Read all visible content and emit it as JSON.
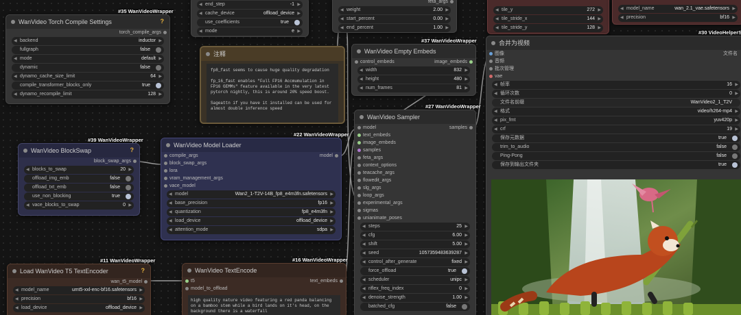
{
  "tags": {
    "compile": "#35 WanVideoWrapper",
    "note_top": "#37 WanVideoWrapper",
    "blockswap": "#39 WanVideoWrapper",
    "loader": "#22 WanVideoWrapper",
    "sampler": "#27 WanVideoWrapper",
    "t5": "#11 WanVideoWrapper",
    "textencode": "#16 WanVideoWrapper",
    "combine": "#30 VideoHelperSui"
  },
  "topleft_partial": {
    "end_step": {
      "label": "end_step",
      "value": "-1"
    },
    "cache_device": {
      "label": "cache_device",
      "value": "offload_device"
    },
    "use_coefficients": {
      "label": "use_coefficients",
      "value": "true"
    },
    "mode": {
      "label": "mode",
      "value": "e"
    }
  },
  "top_mid_partial": {
    "label": "feta_args",
    "weight": {
      "label": "weight",
      "value": "2.00"
    },
    "start_percent": {
      "label": "start_percent",
      "value": "0.00"
    },
    "end_percent": {
      "label": "end_percent",
      "value": "1.00"
    }
  },
  "top_right_partial": {
    "tile_y": {
      "label": "tile_y",
      "value": "272"
    },
    "tile_stride_x": {
      "label": "tile_stride_x",
      "value": "144"
    },
    "tile_stride_y": {
      "label": "tile_stride_y",
      "value": "128"
    },
    "model_name": {
      "label": "model_name",
      "value": "wan_2.1_vae.safetensors"
    },
    "precision": {
      "label": "precision",
      "value": "bf16"
    }
  },
  "compile": {
    "title": "WanVideo Torch Compile Settings",
    "output": "torch_compile_args",
    "backend": {
      "label": "backend",
      "value": "inductor"
    },
    "fullgraph": {
      "label": "fullgraph",
      "value": "false"
    },
    "mode": {
      "label": "mode",
      "value": "default"
    },
    "dynamic": {
      "label": "dynamic",
      "value": "false"
    },
    "cache_size": {
      "label": "dynamo_cache_size_limit",
      "value": "64"
    },
    "transformer_only": {
      "label": "compile_transformer_blocks_only",
      "value": "true"
    },
    "recompile": {
      "label": "dynamo_recompile_limit",
      "value": "128"
    }
  },
  "note": {
    "title": "注释",
    "text": "fp8_fast seems to cause huge quality degradation\n\nfp_16_fast enables \"Full FP16 Accmumulation in FP16 GEMMs\" feature available in the very latest pytorch nightly, this is around 20% speed boost.\n\nSageattn if you have it installed can be used for almost double inference speed"
  },
  "empty_embeds": {
    "title": "WanVideo Empty Embeds",
    "input": "control_embeds",
    "output": "image_embeds",
    "width": {
      "label": "width",
      "value": "832"
    },
    "height": {
      "label": "height",
      "value": "480"
    },
    "num_frames": {
      "label": "num_frames",
      "value": "81"
    }
  },
  "combine": {
    "title": "合并为视频",
    "inputs": [
      "图像",
      "音频",
      "批次管理",
      "vae"
    ],
    "output": "文件名",
    "fps": {
      "label": "帧率",
      "value": "16"
    },
    "loop": {
      "label": "循环次数",
      "value": "0"
    },
    "prefix": {
      "label": "文件名前缀",
      "value": "WanVideo2_1_T2V"
    },
    "format": {
      "label": "格式",
      "value": "video/h264-mp4"
    },
    "pix_fmt": {
      "label": "pix_fmt",
      "value": "yuv420p"
    },
    "crf": {
      "label": "crf",
      "value": "19"
    },
    "save_meta": {
      "label": "保存元数据",
      "value": "true"
    },
    "trim": {
      "label": "trim_to_audio",
      "value": "false"
    },
    "pingpong": {
      "label": "Ping-Pong",
      "value": "false"
    },
    "save_output": {
      "label": "保存到输出文件夹",
      "value": "true"
    }
  },
  "blockswap": {
    "title": "WanVideo BlockSwap",
    "output": "block_swap_args",
    "blocks": {
      "label": "blocks_to_swap",
      "value": "20"
    },
    "offload_img": {
      "label": "offload_img_emb",
      "value": "false"
    },
    "offload_txt": {
      "label": "offload_txt_emb",
      "value": "false"
    },
    "non_blocking": {
      "label": "use_non_blocking",
      "value": "true"
    },
    "vace": {
      "label": "vace_blocks_to_swap",
      "value": "0"
    }
  },
  "loader": {
    "title": "WanVideo Model Loader",
    "inputs": [
      "compile_args",
      "block_swap_args",
      "lora",
      "vram_management_args",
      "vace_model"
    ],
    "output": "model",
    "model": {
      "label": "model",
      "value": "Wan2_1-T2V-14B_fp8_e4m3fn.safetensors"
    },
    "base_precision": {
      "label": "base_precision",
      "value": "fp16"
    },
    "quantization": {
      "label": "quantization",
      "value": "fp8_e4m3fn"
    },
    "load_device": {
      "label": "load_device",
      "value": "offload_device"
    },
    "attention": {
      "label": "attention_mode",
      "value": "sdpa"
    }
  },
  "sampler": {
    "title": "WanVideo Sampler",
    "inputs": [
      "model",
      "text_embeds",
      "image_embeds",
      "samples",
      "feta_args",
      "context_options",
      "teacache_args",
      "flowedit_args",
      "slg_args",
      "loop_args",
      "experimental_args",
      "sigmas",
      "unianimate_poses"
    ],
    "output": "samples",
    "steps": {
      "label": "steps",
      "value": "25"
    },
    "cfg": {
      "label": "cfg",
      "value": "6.00"
    },
    "shift": {
      "label": "shift",
      "value": "5.00"
    },
    "seed": {
      "label": "seed",
      "value": "1057359483639287"
    },
    "control": {
      "label": "control_after_generate",
      "value": "fixed"
    },
    "force_offload": {
      "label": "force_offload",
      "value": "true"
    },
    "scheduler": {
      "label": "scheduler",
      "value": "unipc"
    },
    "riflex": {
      "label": "riflex_freq_index",
      "value": "0"
    },
    "denoise": {
      "label": "denoise_strength",
      "value": "1.00"
    },
    "batched": {
      "label": "batched_cfg",
      "value": "false"
    }
  },
  "t5": {
    "title": "Load WanVideo T5 TextEncoder",
    "output": "wan_t5_model",
    "model_name": {
      "label": "model_name",
      "value": "umt5-xxl-enc-bf16.safetensors"
    },
    "precision": {
      "label": "precision",
      "value": "bf16"
    },
    "load_device": {
      "label": "load_device",
      "value": "offload_device"
    }
  },
  "textencode": {
    "title": "WanVideo TextEncode",
    "inputs": [
      "t5",
      "model_to_offload"
    ],
    "output": "text_embeds",
    "prompt": "high quality nature video featuring a red panda balancing on a bamboo stem while a bird lands on it's head, on the background there is a waterfall"
  },
  "colors": {
    "note_border": "#6b5a3a",
    "blockswap_bg": "#2e2f4a",
    "loader_bg": "#2f3150",
    "t5_bg": "#3c2b24",
    "vae_bg": "#4a2a2a"
  }
}
